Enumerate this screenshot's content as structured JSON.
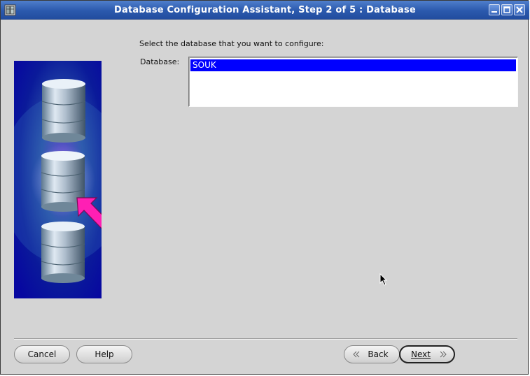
{
  "window": {
    "title": "Database Configuration Assistant, Step 2 of 5 : Database"
  },
  "content": {
    "prompt": "Select the database that you want to configure:",
    "database_label": "Database:",
    "databases": [
      "SOUK"
    ],
    "selected_index": 0
  },
  "buttons": {
    "cancel": "Cancel",
    "help": "Help",
    "back": "Back",
    "next": "Next"
  },
  "colors": {
    "titlebar": "#2b59ad",
    "selection": "#0000ff",
    "dialog_bg": "#d4d4d4",
    "arrow": "#ff1fb4",
    "image_bg": "#0a0a8e"
  },
  "icons": [
    "app-icon",
    "minimize-icon",
    "maximize-icon",
    "close-icon",
    "chevron-left-icon",
    "chevron-right-icon",
    "database-icon",
    "arrow-icon",
    "mouse-pointer-icon"
  ]
}
